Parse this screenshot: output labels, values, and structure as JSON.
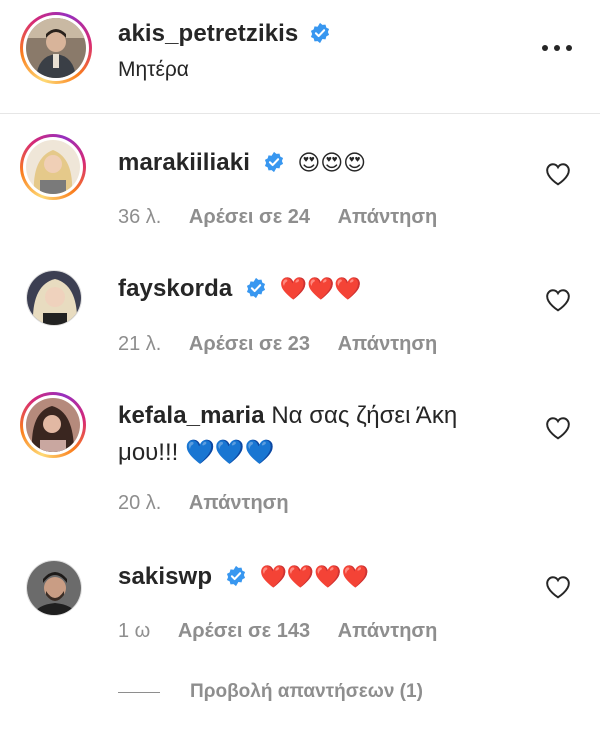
{
  "post": {
    "username": "akis_petretzikis",
    "caption": "Μητέρα"
  },
  "icons": {
    "verified": "verified-badge-icon",
    "more": "more-options-icon",
    "like": "heart-outline-icon"
  },
  "colors": {
    "verified": "#3897f0",
    "meta_text": "#8e8e8e",
    "primary_text": "#262626"
  },
  "comments": [
    {
      "username": "marakiiliaki",
      "text": "😍😍😍",
      "time": "36 λ.",
      "likes": "Αρέσει σε 24",
      "reply": "Απάντηση"
    },
    {
      "username": "fayskorda",
      "text": "❤️❤️❤️",
      "time": "21 λ.",
      "likes": "Αρέσει σε 23",
      "reply": "Απάντηση"
    },
    {
      "username": "kefala_maria",
      "text": "Να σας ζήσει Άκη μου!!! 💙💙💙",
      "time": "20 λ.",
      "reply": "Απάντηση"
    },
    {
      "username": "sakiswp",
      "text": "❤️❤️❤️❤️",
      "time": "1 ω",
      "likes": "Αρέσει σε 143",
      "reply": "Απάντηση"
    }
  ],
  "view_replies": "Προβολή απαντήσεων (1)"
}
